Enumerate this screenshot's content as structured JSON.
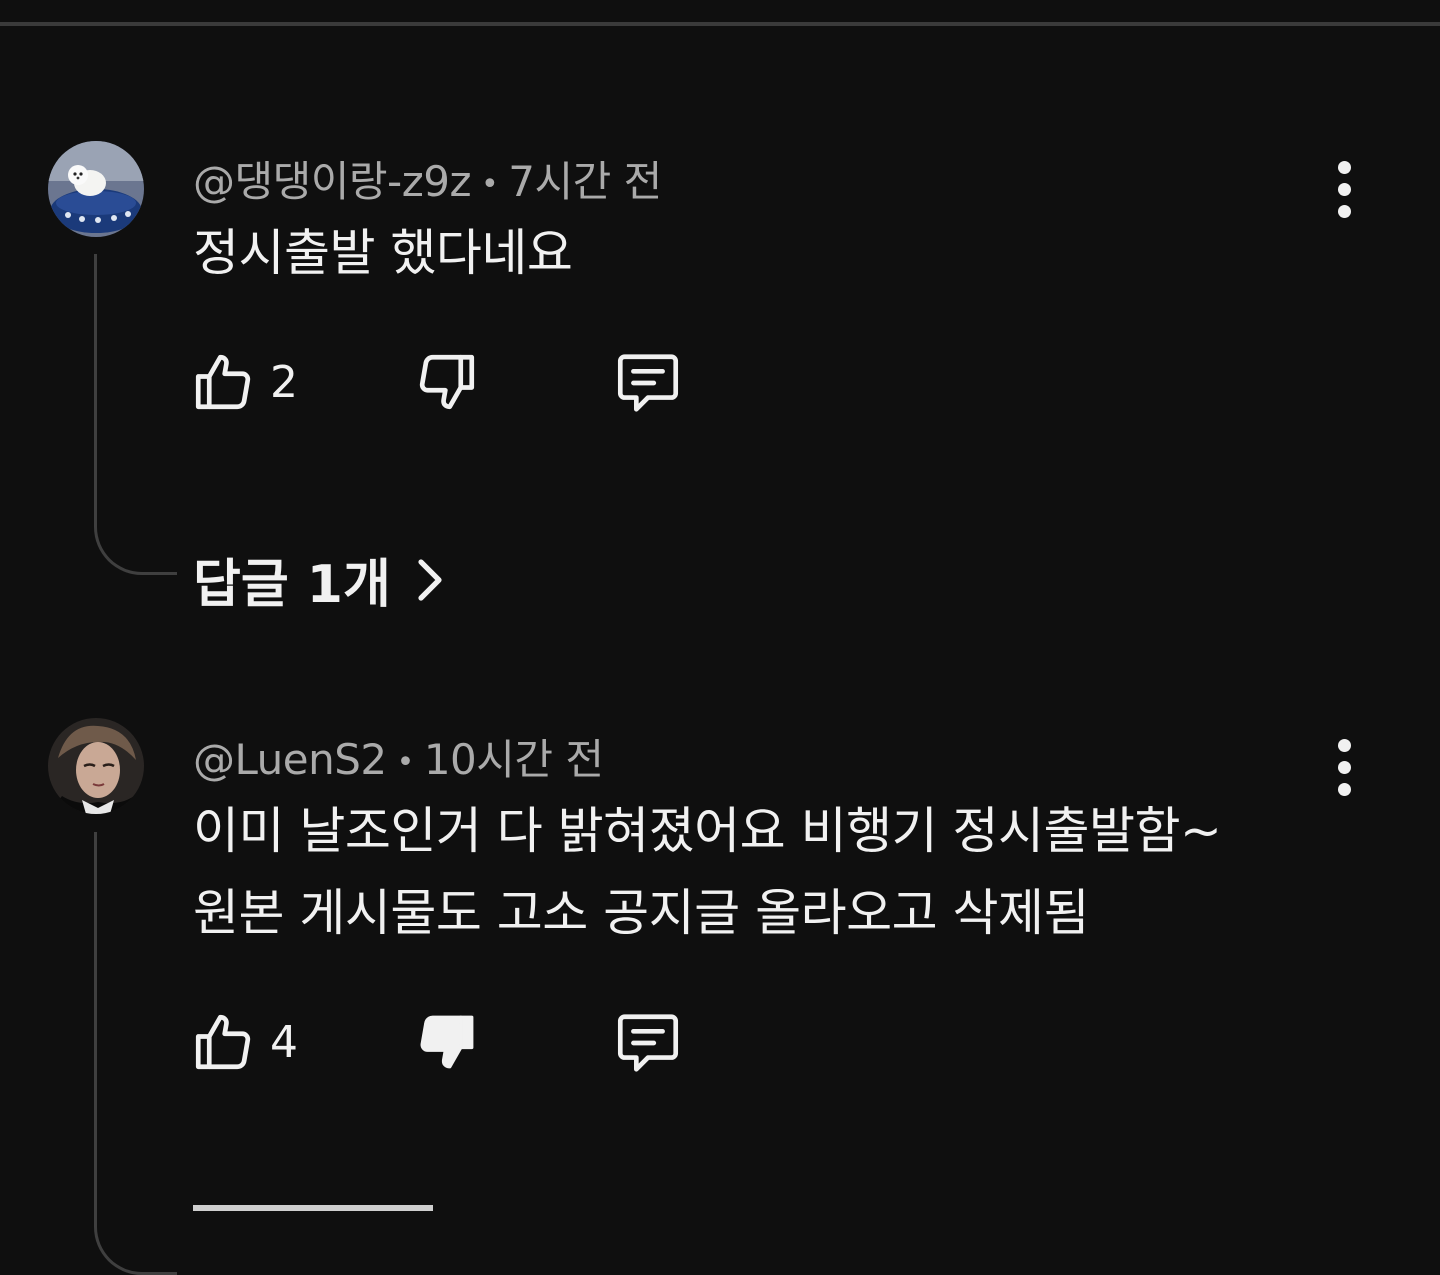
{
  "comments": [
    {
      "author": "@댕댕이랑-z9z",
      "separator": "•",
      "time": "7시간 전",
      "text_lines": [
        "정시출발 했다네요"
      ],
      "likes": "2",
      "replies_label": "답글 1개"
    },
    {
      "author": "@LuenS2",
      "separator": "•",
      "time": "10시간 전",
      "text_lines": [
        "이미 날조인거 다 밝혀졌어요 비행기 정시출발함~",
        "원본 게시물도 고소 공지글 올라오고 삭제됨"
      ],
      "likes": "4"
    }
  ],
  "icons": {
    "like": "thumbs-up-icon",
    "dislike": "thumbs-down-icon",
    "reply": "comment-icon",
    "more": "more-vert-icon",
    "chevron": "chevron-right-icon"
  },
  "colors": {
    "background": "#0f0f0f",
    "text": "#f1f1f1",
    "meta": "#aaaaaa",
    "thread_line": "#3f3f3f"
  }
}
